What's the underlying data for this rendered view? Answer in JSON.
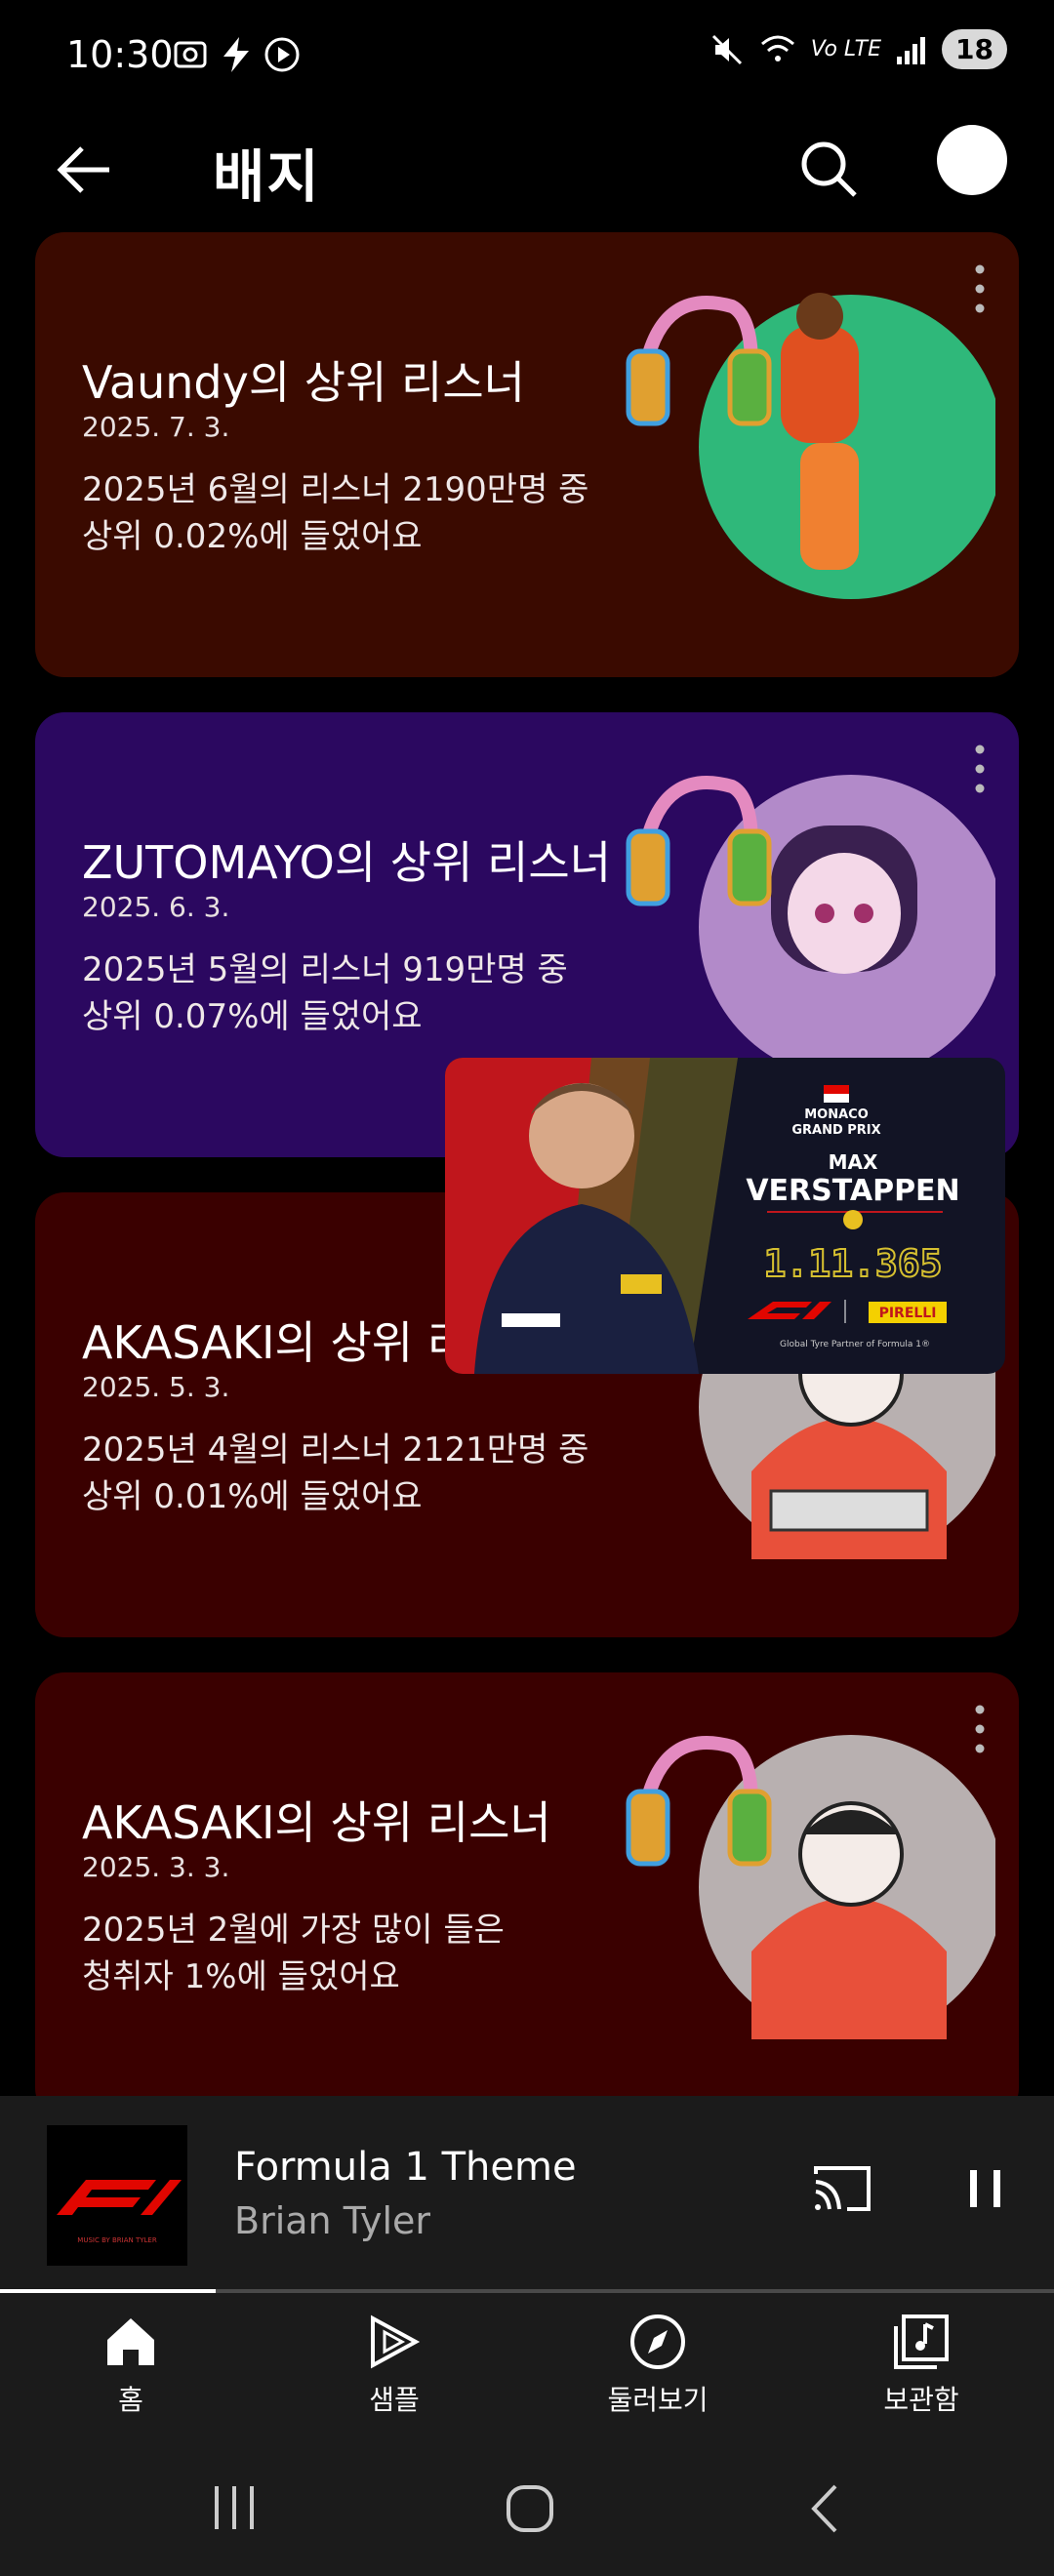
{
  "status": {
    "time": "10:30",
    "network": "Vo LTE",
    "battery": "18"
  },
  "appbar": {
    "title": "배지",
    "back_icon": "arrow-left-icon",
    "search_icon": "search-icon"
  },
  "cards": [
    {
      "title": "Vaundy의 상위 리스너",
      "date": "2025. 7. 3.",
      "desc_line1": "2025년 6월의 리스너 2190만명 중",
      "desc_line2": "상위 0.02%에 들었어요",
      "bg": "#3a0a00",
      "art_bg": "#2fb87a"
    },
    {
      "title": "ZUTOMAYO의 상위 리스너",
      "date": "2025. 6. 3.",
      "desc_line1": "2025년 5월의 리스너 919만명 중",
      "desc_line2": "상위 0.07%에 들었어요",
      "bg": "#2b0860",
      "art_bg": "#b28ac9"
    },
    {
      "title": "AKASAKI의 상위 리",
      "date": "2025. 5. 3.",
      "desc_line1": "2025년 4월의 리스너 2121만명 중",
      "desc_line2": "상위 0.01%에 들었어요",
      "bg": "#3a0000",
      "art_bg": "#b8b0b0"
    },
    {
      "title": "AKASAKI의 상위 리스너",
      "date": "2025. 3. 3.",
      "desc_line1": "2025년 2월에 가장 많이 들은",
      "desc_line2": "청취자 1%에 들었어요",
      "bg": "#3a0000",
      "art_bg": "#b8b0b0"
    }
  ],
  "ad": {
    "line1": "MONACO",
    "line2": "GRAND PRIX",
    "driver_first": "MAX",
    "driver_last": "VERSTAPPEN",
    "lap_time": "1.11.365",
    "brand": "PIRELLI",
    "tagline": "Global Tyre Partner of Formula 1®"
  },
  "player": {
    "title": "Formula 1 Theme",
    "artist": "Brian Tyler",
    "thumb_credit": "MUSIC BY BRIAN TYLER",
    "progress": 0.205
  },
  "nav": [
    {
      "label": "홈",
      "icon": "home-icon"
    },
    {
      "label": "샘플",
      "icon": "samples-play-icon"
    },
    {
      "label": "둘러보기",
      "icon": "explore-compass-icon"
    },
    {
      "label": "보관함",
      "icon": "library-icon"
    }
  ]
}
